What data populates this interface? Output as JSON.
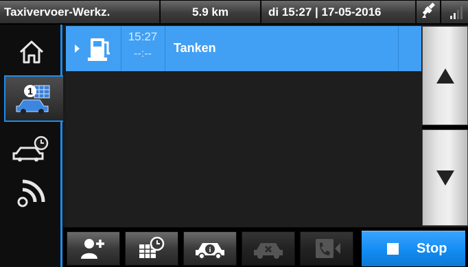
{
  "statusbar": {
    "title": "Taxivervoer-Werkz.",
    "distance": "5.9 km",
    "datetime": "di 15:27 | 17-05-2016",
    "gps_icon": "satellite-icon",
    "signal_icon": "signal-bars-icon"
  },
  "sidebar": {
    "items": [
      {
        "name": "home",
        "icon": "home-icon"
      },
      {
        "name": "active-jobs",
        "icon": "car-jobs-icon",
        "badge": "1"
      },
      {
        "name": "scheduled-jobs",
        "icon": "car-clock-icon"
      },
      {
        "name": "connection",
        "icon": "wifi-signal-icon"
      }
    ]
  },
  "jobs": [
    {
      "time": "15:27",
      "eta": "--:--",
      "label": "Tanken",
      "icon": "fuel-pump-icon"
    }
  ],
  "scroll": {
    "up_icon": "arrow-up-icon",
    "down_icon": "arrow-down-icon"
  },
  "toolbar": {
    "buttons": [
      {
        "name": "add-passenger",
        "icon": "person-add-icon",
        "enabled": true
      },
      {
        "name": "schedule",
        "icon": "calendar-clock-icon",
        "enabled": true
      },
      {
        "name": "taxi-info",
        "icon": "taxi-info-icon",
        "enabled": true
      },
      {
        "name": "cancel-taxi",
        "icon": "taxi-cancel-icon",
        "enabled": false
      },
      {
        "name": "call-forward",
        "icon": "phone-forward-icon",
        "enabled": false
      }
    ],
    "stop_label": "Stop"
  },
  "colors": {
    "accent": "#1c8cf0",
    "row_highlight": "#42a0f4",
    "stop_button": "#128cf2"
  }
}
